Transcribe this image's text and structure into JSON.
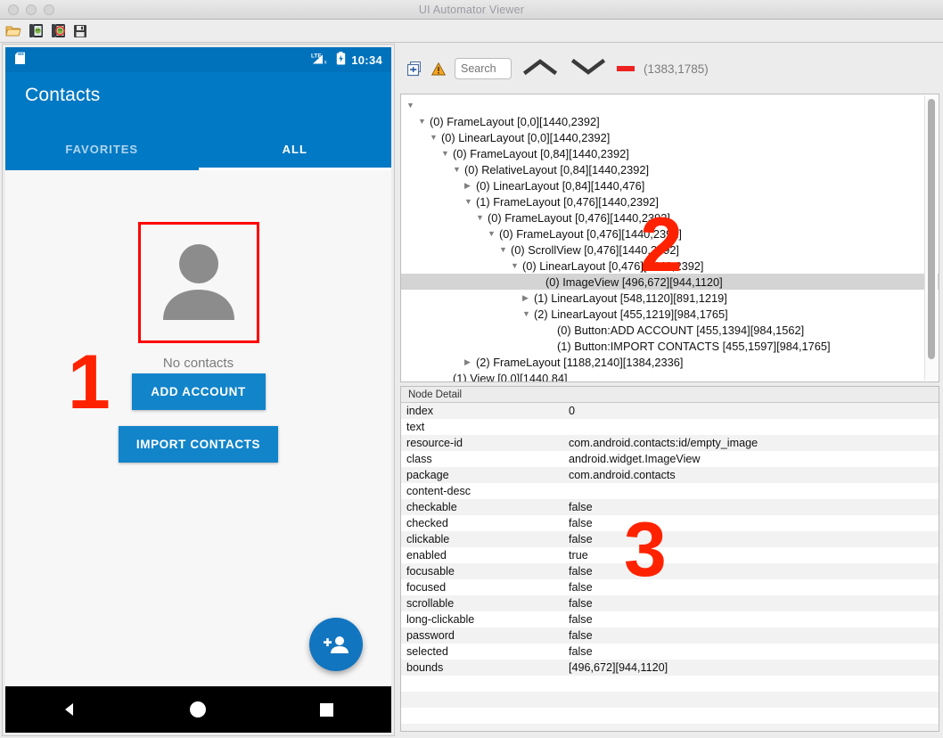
{
  "window": {
    "title": "UI Automator Viewer",
    "traffic_lights": [
      "close",
      "minimize",
      "zoom"
    ]
  },
  "toolbar": {
    "buttons": [
      {
        "name": "open-file",
        "icon": "folder-open-icon"
      },
      {
        "name": "device-screenshot",
        "icon": "device-screenshot-icon"
      },
      {
        "name": "device-screenshot-compressed",
        "icon": "device-screenshot-compressed-icon"
      },
      {
        "name": "save",
        "icon": "save-icon"
      }
    ]
  },
  "device": {
    "status_bar": {
      "time": "10:34",
      "network": "LTE",
      "sdcard_icon": "sdcard-icon",
      "battery_icon": "battery-icon"
    },
    "app_title": "Contacts",
    "tabs": [
      {
        "label": "FAVORITES",
        "active": false
      },
      {
        "label": "ALL",
        "active": true
      }
    ],
    "empty_state": {
      "image_icon": "person-placeholder-icon",
      "caption": "No contacts"
    },
    "buttons": [
      {
        "label": "ADD ACCOUNT"
      },
      {
        "label": "IMPORT CONTACTS"
      }
    ],
    "fab": {
      "icon": "person-add-icon"
    },
    "nav_bar": [
      {
        "name": "back",
        "icon": "back-triangle-icon"
      },
      {
        "name": "home",
        "icon": "home-circle-icon"
      },
      {
        "name": "recents",
        "icon": "recents-square-icon"
      }
    ]
  },
  "search_bar": {
    "expand_icon": "expand-all-icon",
    "warning_icon": "warning-triangle-icon",
    "search_placeholder": "Search",
    "prev_icon": "chevron-up-icon",
    "next_icon": "chevron-down-icon",
    "clear_icon": "red-dash-icon",
    "coordinates": "(1383,1785)"
  },
  "tree": {
    "nodes": [
      {
        "indent": 0,
        "toggle": "expanded",
        "label": ""
      },
      {
        "indent": 1,
        "toggle": "expanded",
        "label": "(0) FrameLayout [0,0][1440,2392]"
      },
      {
        "indent": 2,
        "toggle": "expanded",
        "label": "(0) LinearLayout [0,0][1440,2392]"
      },
      {
        "indent": 3,
        "toggle": "expanded",
        "label": "(0) FrameLayout [0,84][1440,2392]"
      },
      {
        "indent": 4,
        "toggle": "expanded",
        "label": "(0) RelativeLayout [0,84][1440,2392]"
      },
      {
        "indent": 5,
        "toggle": "collapsed",
        "label": "(0) LinearLayout [0,84][1440,476]"
      },
      {
        "indent": 5,
        "toggle": "expanded",
        "label": "(1) FrameLayout [0,476][1440,2392]"
      },
      {
        "indent": 6,
        "toggle": "expanded",
        "label": "(0) FrameLayout [0,476][1440,2392]"
      },
      {
        "indent": 7,
        "toggle": "expanded",
        "label": "(0) FrameLayout [0,476][1440,2392]"
      },
      {
        "indent": 8,
        "toggle": "expanded",
        "label": "(0) ScrollView [0,476][1440,2392]"
      },
      {
        "indent": 9,
        "toggle": "expanded",
        "label": "(0) LinearLayout [0,476][1440,2392]"
      },
      {
        "indent": 11,
        "toggle": "none",
        "label": "(0) ImageView [496,672][944,1120]",
        "selected": true
      },
      {
        "indent": 10,
        "toggle": "collapsed",
        "label": "(1) LinearLayout [548,1120][891,1219]"
      },
      {
        "indent": 10,
        "toggle": "expanded",
        "label": "(2) LinearLayout [455,1219][984,1765]"
      },
      {
        "indent": 12,
        "toggle": "none",
        "label": "(0) Button:ADD ACCOUNT [455,1394][984,1562]"
      },
      {
        "indent": 12,
        "toggle": "none",
        "label": "(1) Button:IMPORT CONTACTS [455,1597][984,1765]"
      },
      {
        "indent": 5,
        "toggle": "collapsed",
        "label": "(2) FrameLayout [1188,2140][1384,2336]"
      },
      {
        "indent": 3,
        "toggle": "none",
        "label": "(1) View [0,0][1440,84]"
      }
    ]
  },
  "node_detail": {
    "header": "Node Detail",
    "rows": [
      {
        "key": "index",
        "value": "0"
      },
      {
        "key": "text",
        "value": ""
      },
      {
        "key": "resource-id",
        "value": "com.android.contacts:id/empty_image"
      },
      {
        "key": "class",
        "value": "android.widget.ImageView"
      },
      {
        "key": "package",
        "value": "com.android.contacts"
      },
      {
        "key": "content-desc",
        "value": ""
      },
      {
        "key": "checkable",
        "value": "false"
      },
      {
        "key": "checked",
        "value": "false"
      },
      {
        "key": "clickable",
        "value": "false"
      },
      {
        "key": "enabled",
        "value": "true"
      },
      {
        "key": "focusable",
        "value": "false"
      },
      {
        "key": "focused",
        "value": "false"
      },
      {
        "key": "scrollable",
        "value": "false"
      },
      {
        "key": "long-clickable",
        "value": "false"
      },
      {
        "key": "password",
        "value": "false"
      },
      {
        "key": "selected",
        "value": "false"
      },
      {
        "key": "bounds",
        "value": "[496,672][944,1120]"
      }
    ]
  },
  "annotations": [
    {
      "label": "1"
    },
    {
      "label": "2"
    },
    {
      "label": "3"
    }
  ],
  "colors": {
    "android_blue": "#0279c4",
    "status_blue": "#0072bc",
    "button_blue": "#1284ca",
    "annotation_red": "#ff2200",
    "selection_red": "#ff0000"
  }
}
